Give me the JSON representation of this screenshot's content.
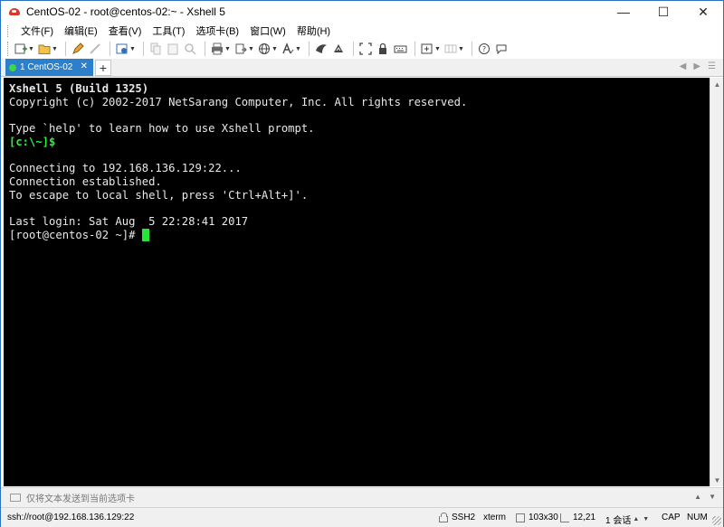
{
  "window": {
    "title": "CentOS-02 - root@centos-02:~ - Xshell 5",
    "controls": {
      "minimize": "—",
      "maximize": "☐",
      "close": "✕"
    }
  },
  "menu": {
    "items": [
      "文件(F)",
      "编辑(E)",
      "查看(V)",
      "工具(T)",
      "选项卡(B)",
      "窗口(W)",
      "帮助(H)"
    ]
  },
  "toolbar": {
    "icons": [
      "new-session-icon",
      "open-folder-icon",
      "edit-icon",
      "disconnect-icon",
      "properties-icon",
      "copy-icon",
      "paste-icon",
      "find-icon",
      "print-icon",
      "transfer-icon",
      "globe-icon",
      "font-icon",
      "xftp-icon",
      "xmanager-icon",
      "fullscreen-icon",
      "lock-icon",
      "keyboard-icon",
      "compose-icon",
      "layout-icon",
      "help-icon",
      "chat-icon"
    ]
  },
  "tabs": [
    {
      "label": "1 CentOS-02",
      "status_color": "#3fd64b",
      "active": true
    }
  ],
  "tab_add_label": "+",
  "terminal": {
    "background": "#000000",
    "lines": [
      {
        "text": "Xshell 5 (Build 1325)",
        "style": "bold"
      },
      {
        "text": "Copyright (c) 2002-2017 NetSarang Computer, Inc. All rights reserved.",
        "style": "normal"
      },
      {
        "text": "",
        "style": "normal"
      },
      {
        "text": "Type `help' to learn how to use Xshell prompt.",
        "style": "normal"
      },
      {
        "text": "[c:\\~]$",
        "style": "green"
      },
      {
        "text": "",
        "style": "normal"
      },
      {
        "text": "Connecting to 192.168.136.129:22...",
        "style": "normal"
      },
      {
        "text": "Connection established.",
        "style": "normal"
      },
      {
        "text": "To escape to local shell, press 'Ctrl+Alt+]'.",
        "style": "normal"
      },
      {
        "text": "",
        "style": "normal"
      },
      {
        "text": "Last login: Sat Aug  5 22:28:41 2017",
        "style": "normal"
      },
      {
        "text": "[root@centos-02 ~]# ",
        "style": "prompt"
      }
    ],
    "cursor_color": "#24e636"
  },
  "compose": {
    "placeholder": "仅将文本发送到当前选项卡"
  },
  "status": {
    "connection": "ssh://root@192.168.136.129:22",
    "protocol": "SSH2",
    "terminal_type": "xterm",
    "size": "103x30",
    "cursor_pos": "12,21",
    "sessions": "1 会话",
    "caps": "CAP",
    "num": "NUM"
  }
}
